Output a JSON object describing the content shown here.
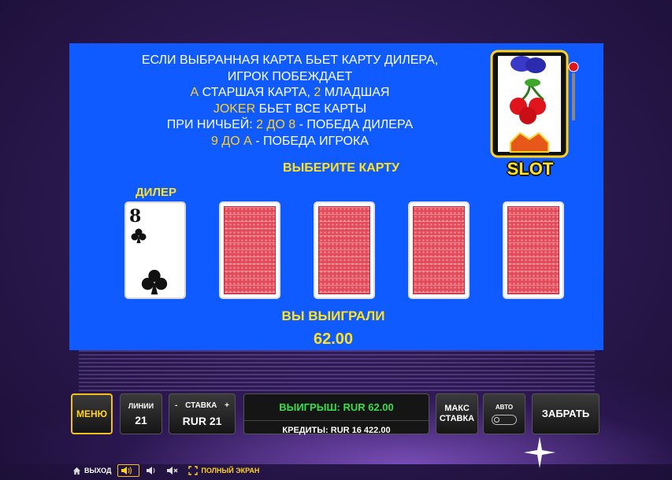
{
  "rules": {
    "line1": "ЕСЛИ ВЫБРАННАЯ КАРТА БЬЕТ КАРТУ ДИЛЕРА,",
    "line2": "ИГРОК ПОБЕЖДАЕТ",
    "line3_a": "А",
    "line3_mid": " СТАРШАЯ КАРТА, ",
    "line3_two": "2",
    "line3_end": " МЛАДШАЯ",
    "line4_joker": "JOKER",
    "line4_end": " БЬЕТ ВСЕ КАРТЫ",
    "line5_start": "ПРИ НИЧЬЕЙ: ",
    "line5_range": "2 ДО 8",
    "line5_end": " - ПОБЕДА ДИЛЕРА",
    "line6_range": "9 ДО А",
    "line6_end": " - ПОБЕДА ИГРОКА"
  },
  "select_title": "ВЫБЕРИТЕ КАРТУ",
  "dealer_label": "ДИЛЕР",
  "dealer_card": {
    "rank": "8",
    "suit": "clubs-icon"
  },
  "logo_text": "SLOT",
  "win_label": "ВЫ ВЫИГРАЛИ",
  "win_amount": "62.00",
  "controls": {
    "menu": "МЕНЮ",
    "lines_label": "ЛИНИИ",
    "lines_value": "21",
    "bet_minus": "-",
    "bet_label": "СТАВКА",
    "bet_plus": "+",
    "bet_value": "RUR 21",
    "win_text": "ВЫИГРЫШ:  RUR 62.00",
    "credits_text": "КРЕДИТЫ:  RUR 16 422.00",
    "max_line1": "МАКС",
    "max_line2": "СТАВКА",
    "auto_label": "АВТО",
    "collect": "ЗАБРАТЬ"
  },
  "bottom_bar": {
    "exit": "ВЫХОД",
    "fullscreen": "ПОЛНЫЙ ЭКРАН"
  },
  "colors": {
    "panel": "#0f5bff",
    "accent_yellow": "#ffe21f",
    "win_green": "#33e04a",
    "card_back": "#e34b5a"
  }
}
